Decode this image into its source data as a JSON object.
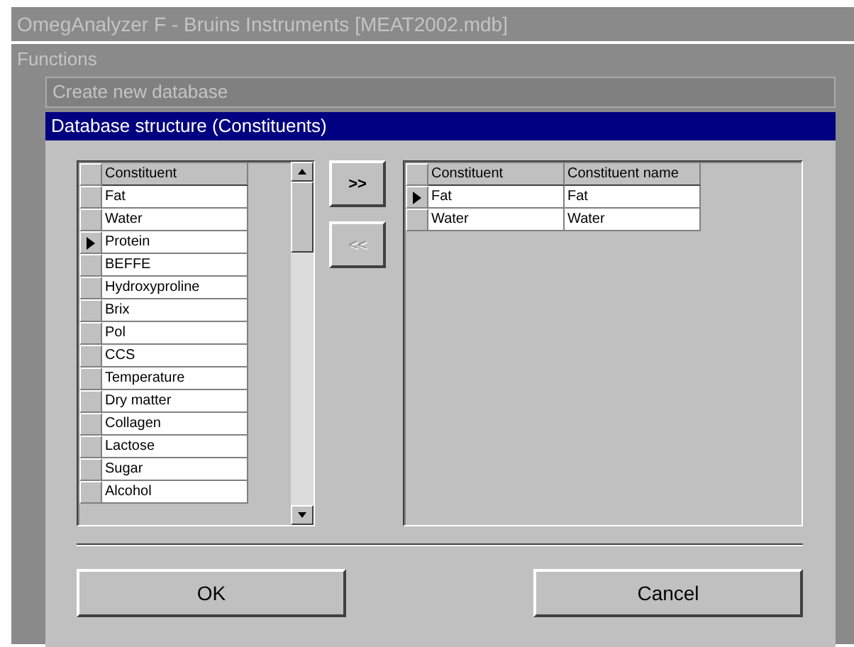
{
  "window": {
    "title": "OmegAnalyzer F - Bruins Instruments [MEAT2002.mdb]"
  },
  "menu_bar": {
    "label": "Functions"
  },
  "breadcrumb": {
    "label": "Create new database"
  },
  "dialog": {
    "title": "Database structure (Constituents)"
  },
  "available_grid": {
    "columns": [
      "Constituent"
    ],
    "rows": [
      {
        "cells": [
          "Fat"
        ],
        "selected": false
      },
      {
        "cells": [
          "Water"
        ],
        "selected": false
      },
      {
        "cells": [
          "Protein"
        ],
        "selected": true
      },
      {
        "cells": [
          "BEFFE"
        ],
        "selected": false
      },
      {
        "cells": [
          "Hydroxyproline"
        ],
        "selected": false
      },
      {
        "cells": [
          "Brix"
        ],
        "selected": false
      },
      {
        "cells": [
          "Pol"
        ],
        "selected": false
      },
      {
        "cells": [
          "CCS"
        ],
        "selected": false
      },
      {
        "cells": [
          "Temperature"
        ],
        "selected": false
      },
      {
        "cells": [
          "Dry matter"
        ],
        "selected": false
      },
      {
        "cells": [
          "Collagen"
        ],
        "selected": false
      },
      {
        "cells": [
          "Lactose"
        ],
        "selected": false
      },
      {
        "cells": [
          "Sugar"
        ],
        "selected": false
      },
      {
        "cells": [
          "Alcohol"
        ],
        "selected": false
      }
    ]
  },
  "move_buttons": [
    {
      "label": ">>",
      "disabled": false
    },
    {
      "label": "<<",
      "disabled": true
    }
  ],
  "selected_grid": {
    "columns": [
      "Constituent",
      "Constituent name"
    ],
    "rows": [
      {
        "cells": [
          "Fat",
          "Fat"
        ],
        "selected": true
      },
      {
        "cells": [
          "Water",
          "Water"
        ],
        "selected": false
      }
    ]
  },
  "buttons": [
    "OK",
    "Cancel"
  ]
}
